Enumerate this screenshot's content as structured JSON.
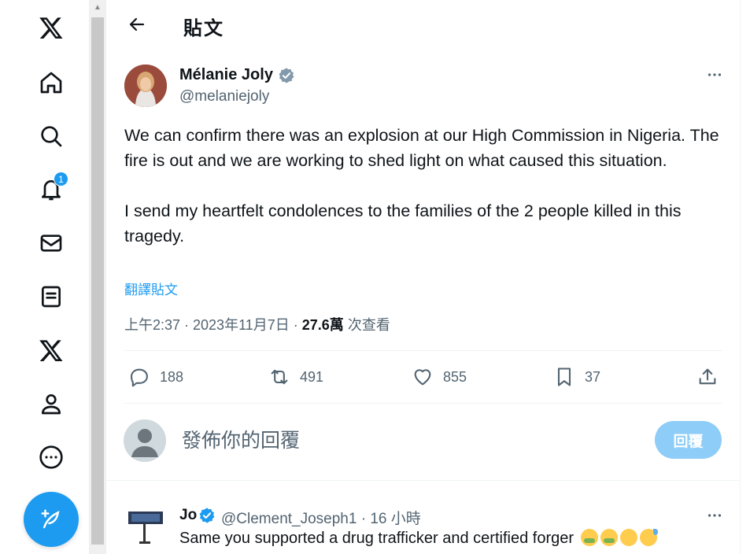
{
  "nav": {
    "notification_count": "1"
  },
  "header": {
    "title": "貼文"
  },
  "tweet": {
    "author_name": "Mélanie Joly",
    "author_handle": "@melaniejoly",
    "paragraph1": "We can confirm there was an explosion at our High Commission in Nigeria. The fire is out and we are working to shed light on what caused this situation.",
    "paragraph2": "I send my heartfelt condolences to the families of the 2 people killed in this tragedy.",
    "translate_label": "翻譯貼文",
    "timestamp": "上午2:37 · 2023年11月7日 · ",
    "views_count": "27.6萬",
    "views_label": " 次查看"
  },
  "actions": {
    "replies": "188",
    "reposts": "491",
    "likes": "855",
    "bookmarks": "37"
  },
  "reply_box": {
    "placeholder": "發佈你的回覆",
    "button_label": "回覆"
  },
  "reply": {
    "name": "Jo",
    "handle_and_time": "@Clement_Joseph1 · 16 小時",
    "text": "Same you supported a drug trafficker and certified forger"
  },
  "colors": {
    "accent": "#1d9bf0",
    "secondary_text": "#536471",
    "primary_text": "#0f1419"
  },
  "icons": [
    "x-logo-icon",
    "home-icon",
    "search-icon",
    "bell-icon",
    "mail-icon",
    "lists-icon",
    "x-premium-icon",
    "profile-icon",
    "more-circle-icon",
    "compose-icon",
    "back-arrow-icon",
    "verified-icon",
    "more-icon",
    "reply-icon",
    "repost-icon",
    "like-icon",
    "bookmark-icon",
    "share-icon"
  ]
}
